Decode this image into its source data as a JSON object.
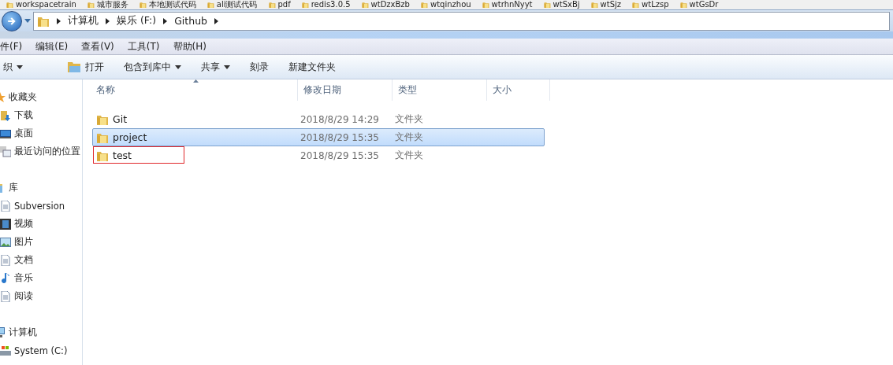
{
  "bookmarks": [
    {
      "label": "workspacetrain"
    },
    {
      "label": "城市服务"
    },
    {
      "label": "本地测试代码"
    },
    {
      "label": "ali测试代码"
    },
    {
      "label": "pdf"
    },
    {
      "label": "redis3.0.5"
    },
    {
      "label": "wtDzxBzb"
    },
    {
      "label": "wtqinzhou"
    },
    {
      "label": "wtrhnNyyt"
    },
    {
      "label": "wtSxBj"
    },
    {
      "label": "wtSjz"
    },
    {
      "label": "wtLzsp"
    },
    {
      "label": "wtGsDr"
    }
  ],
  "address": {
    "crumbs": [
      "计算机",
      "娱乐 (F:)",
      "Github"
    ]
  },
  "menu": [
    "件(F)",
    "编辑(E)",
    "查看(V)",
    "工具(T)",
    "帮助(H)"
  ],
  "toolbar": [
    {
      "label": "织",
      "kind": "dropdown"
    },
    {
      "label": "打开",
      "kind": "icon"
    },
    {
      "label": "包含到库中",
      "kind": "dropdown"
    },
    {
      "label": "共享",
      "kind": "dropdown"
    },
    {
      "label": "刻录",
      "kind": "plain"
    },
    {
      "label": "新建文件夹",
      "kind": "plain"
    }
  ],
  "sidebar": {
    "items": [
      {
        "label": "收藏夹",
        "children": [
          {
            "label": "下载"
          },
          {
            "label": "桌面"
          },
          {
            "label": "最近访问的位置"
          }
        ]
      },
      {
        "label": "库",
        "children": [
          {
            "label": "Subversion"
          },
          {
            "label": "视频"
          },
          {
            "label": "图片"
          },
          {
            "label": "文档"
          },
          {
            "label": "音乐"
          },
          {
            "label": "阅读"
          }
        ]
      },
      {
        "label": "计算机",
        "children": [
          {
            "label": "System (C:)"
          }
        ]
      }
    ]
  },
  "table": {
    "columns": [
      {
        "label": "名称",
        "sorted": true
      },
      {
        "label": "修改日期",
        "sorted": false
      },
      {
        "label": "类型",
        "sorted": false
      },
      {
        "label": "大小",
        "sorted": false
      }
    ],
    "rows": [
      {
        "name": "Git",
        "date": "2018/8/29 14:29",
        "type": "文件夹",
        "selected": false,
        "marked": false
      },
      {
        "name": "project",
        "date": "2018/8/29 15:35",
        "type": "文件夹",
        "selected": true,
        "marked": false
      },
      {
        "name": "test",
        "date": "2018/8/29 15:35",
        "type": "文件夹",
        "selected": false,
        "marked": true
      }
    ]
  }
}
